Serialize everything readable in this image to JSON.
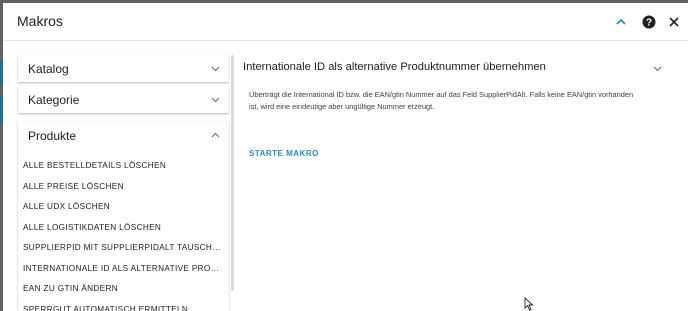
{
  "dialog": {
    "title": "Makros",
    "icons": {
      "collapse": "chevron-up-icon",
      "help": "help-circle-icon",
      "close": "close-icon"
    },
    "accent_color": "#2a8fbf"
  },
  "sidebar": {
    "panels": [
      {
        "label": "Katalog",
        "expanded": false
      },
      {
        "label": "Kategorie",
        "expanded": false
      },
      {
        "label": "Produkte",
        "expanded": true
      }
    ],
    "items": [
      "ALLE BESTELLDETAILS LÖSCHEN",
      "ALLE PREISE LÖSCHEN",
      "ALLE UDX LÖSCHEN",
      "ALLE LOGISTIKDATEN LÖSCHEN",
      "SUPPLIERPID MIT SUPPLIERPIDALT TAUSCHEN",
      "INTERNATIONALE ID ALS ALTERNATIVE PRODUKTNUMMER ÜBERNEHMEN",
      "EAN ZU GTIN ÄNDERN",
      "SPERRGUT AUTOMATISCH ERMITTELN"
    ]
  },
  "detail": {
    "title": "Internationale ID als alternative Produktnummer übernehmen",
    "description": "Überträgt die International ID bzw. die EAN/gtin Nummer auf das Feld SupplierPidAlt. Falls keine EAN/gtin vorhanden ist, wird eine eindeutige aber ungültige Nummer erzeugt.",
    "button_label": "STARTE MAKRO"
  }
}
